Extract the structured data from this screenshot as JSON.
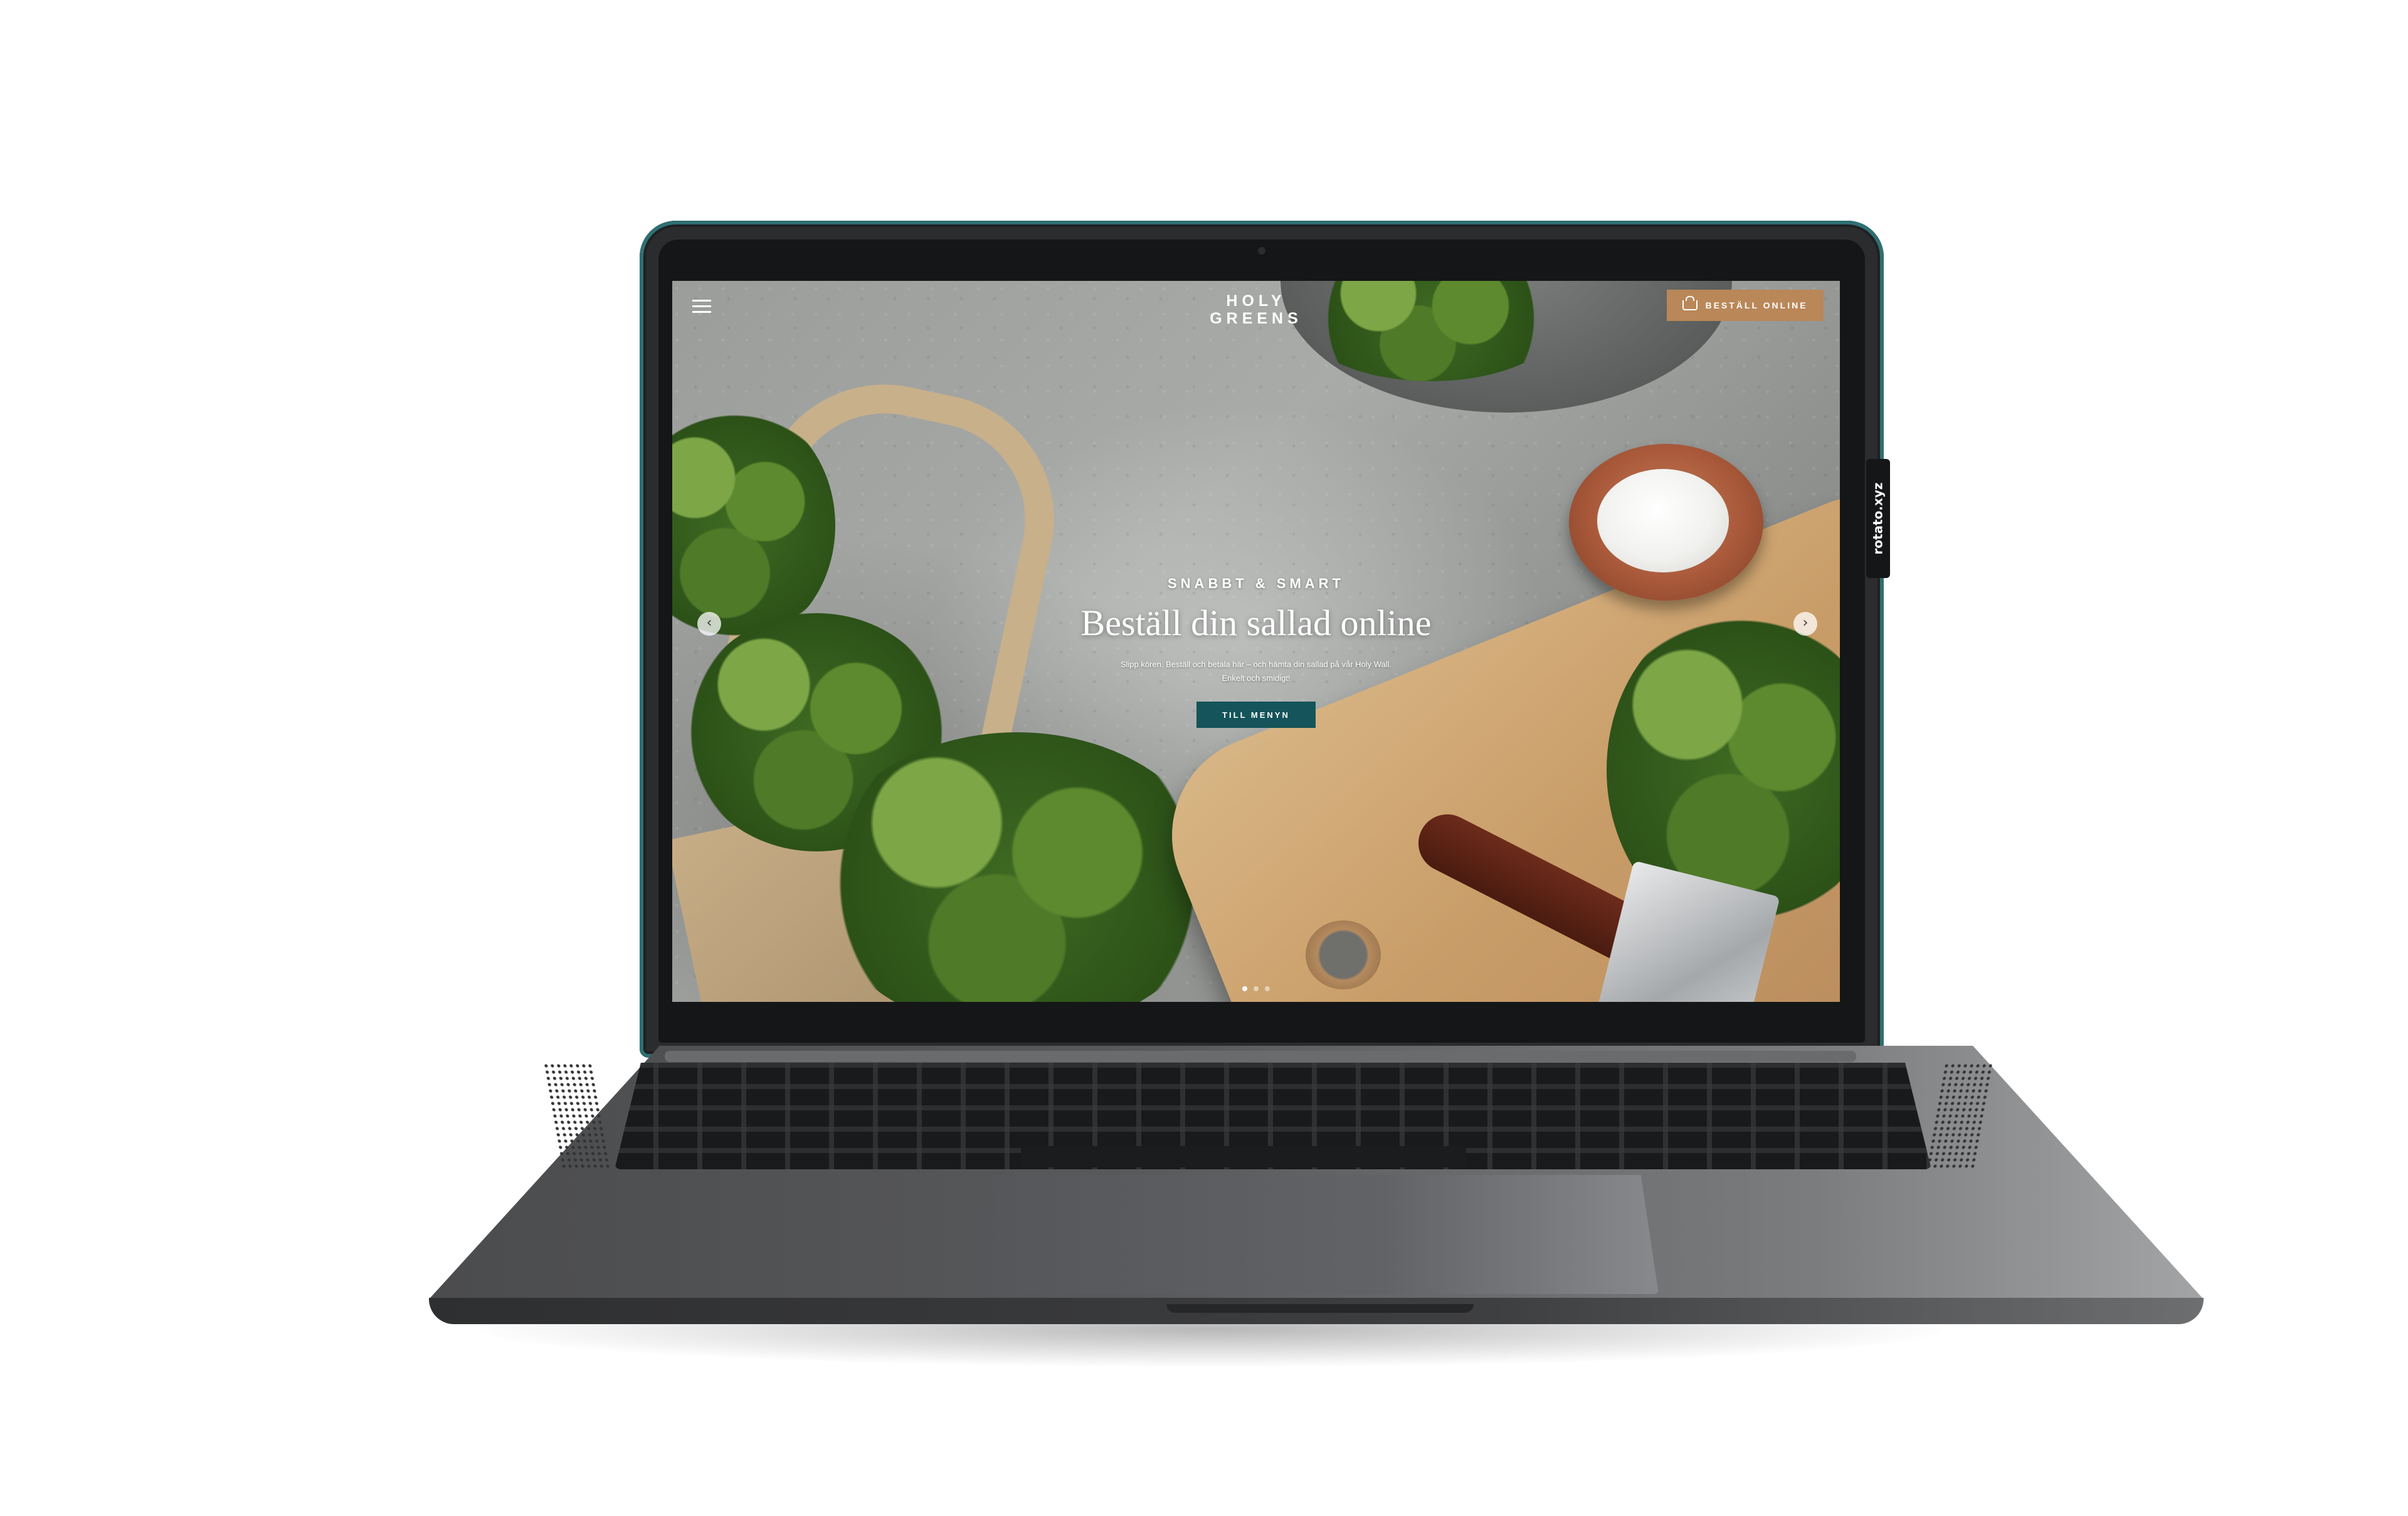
{
  "site": {
    "logo_line1": "HOLY",
    "logo_line2": "GREENS",
    "order_button": "BESTÄLL ONLINE",
    "menu_icon": "hamburger-icon",
    "basket_icon": "basket-icon"
  },
  "hero": {
    "eyebrow": "SNABBT & SMART",
    "headline": "Beställ din sallad online",
    "subline": "Slipp kören. Beställ och betala här – och hämta din sallad på vår Holy Wall. Enkelt och smidigt!",
    "cta": "TILL MENYN",
    "prev_arrow": "‹",
    "next_arrow": "›",
    "slides": 3,
    "active_slide": 1
  },
  "colors": {
    "accent_order": "#b98758",
    "accent_cta": "#14545a",
    "laptop_edge": "#2f6f72"
  },
  "watermark": "rotato.xyz"
}
